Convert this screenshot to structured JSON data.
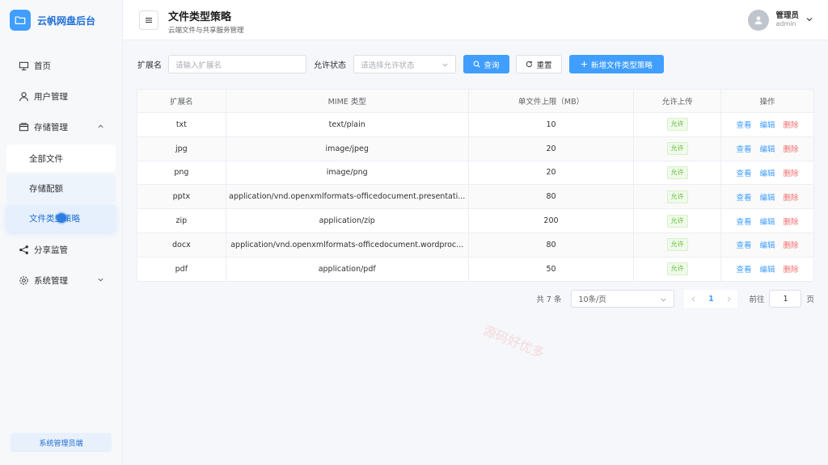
{
  "brand": {
    "title": "云帆网盘后台"
  },
  "sidebar": {
    "items": [
      {
        "label": "首页"
      },
      {
        "label": "用户管理"
      },
      {
        "label": "存储管理"
      },
      {
        "label": "分享监管"
      },
      {
        "label": "系统管理"
      }
    ],
    "sub_items": [
      {
        "label": "全部文件"
      },
      {
        "label": "存储配额"
      },
      {
        "label": "文件类型策略"
      }
    ],
    "footer": "系统管理员端"
  },
  "header": {
    "title": "文件类型策略",
    "subtitle": "云端文件与共享服务管理",
    "user_name": "管理员",
    "user_id": "admin"
  },
  "filters": {
    "ext_label": "扩展名",
    "ext_placeholder": "请输入扩展名",
    "status_label": "允许状态",
    "status_placeholder": "请选择允许状态",
    "search_label": "查询",
    "reset_label": "重置",
    "add_label": "新增文件类型策略"
  },
  "table": {
    "headers": [
      "扩展名",
      "MIME 类型",
      "单文件上限（MB）",
      "允许上传",
      "操作"
    ],
    "rows": [
      {
        "ext": "txt",
        "mime": "text/plain",
        "limit": "10",
        "allow": "允许"
      },
      {
        "ext": "jpg",
        "mime": "image/jpeg",
        "limit": "20",
        "allow": "允许"
      },
      {
        "ext": "png",
        "mime": "image/png",
        "limit": "20",
        "allow": "允许"
      },
      {
        "ext": "pptx",
        "mime": "application/vnd.openxmlformats-officedocument.presentati...",
        "limit": "80",
        "allow": "允许"
      },
      {
        "ext": "zip",
        "mime": "application/zip",
        "limit": "200",
        "allow": "允许"
      },
      {
        "ext": "docx",
        "mime": "application/vnd.openxmlformats-officedocument.wordproc...",
        "limit": "80",
        "allow": "允许"
      },
      {
        "ext": "pdf",
        "mime": "application/pdf",
        "limit": "50",
        "allow": "允许"
      }
    ],
    "actions": {
      "view": "查看",
      "edit": "编辑",
      "delete": "删除"
    }
  },
  "pagination": {
    "total": "共 7 条",
    "page_size": "10条/页",
    "current_page": "1",
    "goto_label": "前往",
    "goto_value": "1",
    "page_unit": "页"
  },
  "watermarks": [
    "源码好优多",
    "好优多",
    "源码好优多"
  ],
  "colors": {
    "primary": "#409eff",
    "danger": "#f56c6c",
    "success": "#67c23a"
  }
}
